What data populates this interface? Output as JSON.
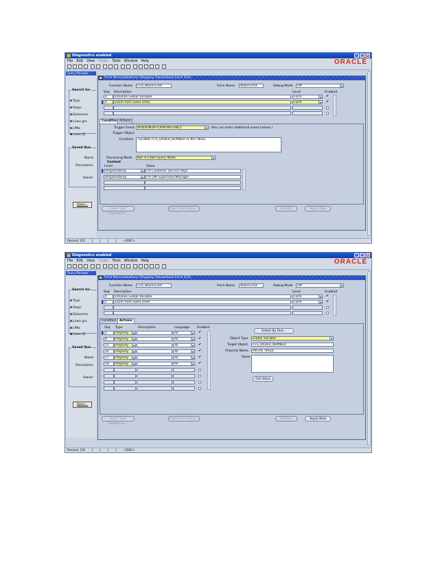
{
  "colors": {
    "titlebar": "#1f5fd6",
    "highlight": "#ffff99",
    "oracle": "#d5261b",
    "panel": "#c5cfe0"
  },
  "s1": {
    "title": "Diagnostics enabled",
    "menu": [
      "File",
      "Edit",
      "View",
      "Folder",
      "Tools",
      "Window",
      "Help"
    ],
    "brand": "ORACLE",
    "qm_title": "Query Manager",
    "search_for": "Search for",
    "radios": [
      "Trips",
      "Stops",
      "Deliveries",
      "Lines gro",
      "LPNs",
      "Lines (D"
    ],
    "saved": "Saved Que",
    "name_lbl": "Name",
    "desc_lbl": "Description",
    "owner_lbl": "Owner",
    "open_btn": "Open...",
    "fp_title": "Form Personalizations (Shipping Transactions Form FCA)",
    "fn_lbl": "Function Name",
    "fn_val": "FCA_WSHFSTRX",
    "form_lbl": "Form Name",
    "form_val": "WSHFSTRX",
    "dbg_lbl": "Debug Mode",
    "dbg_val": "Off",
    "seq_hdr": "Seq",
    "desc_hdr": "Description",
    "level_hdr": "Level",
    "enabled_hdr": "Enabled",
    "rows": [
      {
        "seq": "4",
        "desc": "Initialize Global Variable",
        "level": "Form"
      },
      {
        "seq": "5",
        "desc": "Zoom from Sales order",
        "level": "Form"
      }
    ],
    "tab_condition": "Condition",
    "tab_actions": "Actions",
    "trig_lbl": "Trigger Event",
    "trig_val": "WHEN-NEW-FORM-INSTANCE",
    "trig_hint": "(You can enter additional event names.)",
    "trigobj_lbl": "Trigger Object",
    "cond_lbl": "Condition",
    "cond_val": ":GLOBAL.FCS_ORDER_NUMBER IS NOT NULL",
    "pm_lbl": "Processing Mode",
    "pm_val": "Not in Enter-Query Mode",
    "ctx_lbl": "Context",
    "ctx_level": "Level",
    "ctx_value": "Value",
    "ctx_rows": [
      {
        "level": "Responsibility",
        "value": "ITA Customer Service Reps"
      },
      {
        "level": "Responsibility",
        "value": "ITA OM Supervisor/Manager"
      }
    ],
    "b_insget": "Insert 'Get' Expression...",
    "b_insitem": "Insert Item Value...",
    "b_validate": "Validate",
    "b_apply": "Apply Now",
    "record": "Record: 2/2",
    "osc": "<OSC>"
  },
  "s2": {
    "title": "Diagnostics enabled",
    "menu": [
      "File",
      "Edit",
      "View",
      "Folder",
      "Tools",
      "Window",
      "Help"
    ],
    "brand": "ORACLE",
    "qm_title": "Query Manager",
    "search_for": "Search for",
    "radios": [
      "Trips",
      "Stops",
      "Deliveries",
      "Lines gro",
      "LPNs",
      "Lines (D"
    ],
    "saved": "Saved Que",
    "name_lbl": "Name",
    "desc_lbl": "Description",
    "owner_lbl": "Owner",
    "open_btn": "Open...",
    "fp_title": "Form Personalizations (Shipping Transactions Form FCA)",
    "fn_lbl": "Function Name",
    "fn_val": "FCA_WSHFSTRX",
    "form_lbl": "Form Name",
    "form_val": "WSHFSTRX",
    "dbg_lbl": "Debug Mode",
    "dbg_val": "Off",
    "seq_hdr": "Seq",
    "desc_hdr": "Description",
    "level_hdr": "Level",
    "enabled_hdr": "Enabled",
    "rows": [
      {
        "seq": "4",
        "desc": "Initialize Global Variable",
        "level": "Form"
      },
      {
        "seq": "5",
        "desc": "Zoom from Sales order",
        "level": "Form"
      }
    ],
    "tab_condition": "Condition",
    "tab_actions": "Actions",
    "act_hdr": {
      "seq": "Seq",
      "type": "Type",
      "desc": "Description",
      "lang": "Language",
      "enabled": "Enabled"
    },
    "act_rows": [
      {
        "seq": "2",
        "type": "Property",
        "lang": "All"
      },
      {
        "seq": "8",
        "type": "Property",
        "lang": "All"
      },
      {
        "seq": "11",
        "type": "Property",
        "lang": "All"
      },
      {
        "seq": "14",
        "type": "Property",
        "lang": "All"
      },
      {
        "seq": "17",
        "type": "Property",
        "lang": "All"
      },
      {
        "seq": "18",
        "type": "Property",
        "lang": "All"
      }
    ],
    "select_by_text": "Select By Text...",
    "objtype_lbl": "Object Type",
    "objtype_val": "Global Variable",
    "target_lbl": "Target Object",
    "target_val": "FCS_ORDER_NUMBER",
    "prop_lbl": "Property Name",
    "prop_val": "INITIAL VALUE",
    "value_lbl": "Value",
    "get_value": "Get Value",
    "b_insget": "Insert 'Get' Expression...",
    "b_insitem": "Insert Item Value...",
    "b_validate": "Validate",
    "b_apply": "Apply Now",
    "record": "Record: 1/6",
    "osc": "<OSC>"
  }
}
